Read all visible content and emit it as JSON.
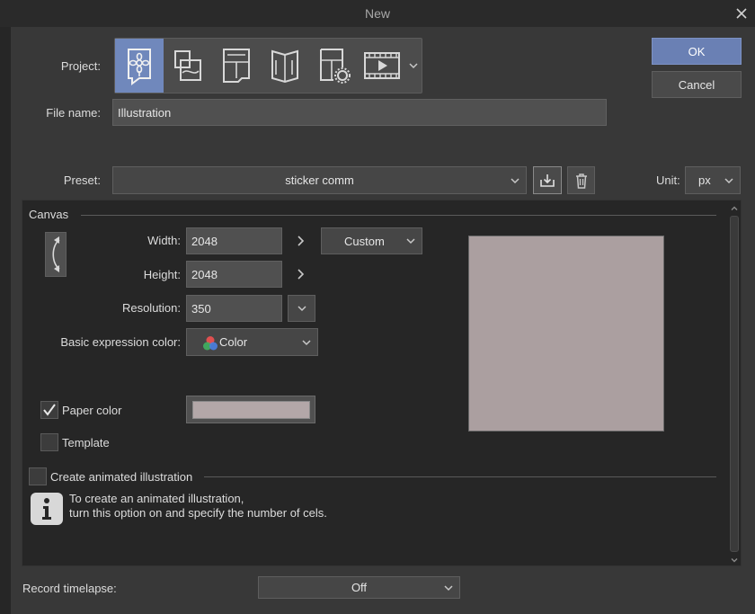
{
  "window": {
    "title": "New"
  },
  "project": {
    "label": "Project:",
    "types": [
      {
        "name": "illustration",
        "icon": "illustration-icon",
        "selected": true
      },
      {
        "name": "webtoon",
        "icon": "webtoon-icon",
        "selected": false
      },
      {
        "name": "comic",
        "icon": "comic-icon",
        "selected": false
      },
      {
        "name": "book",
        "icon": "book-icon",
        "selected": false
      },
      {
        "name": "comic-settings",
        "icon": "comic-settings-icon",
        "selected": false
      },
      {
        "name": "animation",
        "icon": "animation-icon",
        "selected": false
      }
    ]
  },
  "file_name": {
    "label": "File name:",
    "value": "Illustration"
  },
  "preset": {
    "label": "Preset:",
    "value": "sticker comm"
  },
  "unit": {
    "label": "Unit:",
    "value": "px"
  },
  "buttons": {
    "ok": "OK",
    "cancel": "Cancel"
  },
  "canvas": {
    "section_label": "Canvas",
    "width_label": "Width:",
    "width": "2048",
    "height_label": "Height:",
    "height": "2048",
    "size_preset": "Custom",
    "resolution_label": "Resolution:",
    "resolution": "350",
    "color_mode_label": "Basic expression color:",
    "color_mode": "Color",
    "paper_color_label": "Paper color",
    "paper_color_checked": true,
    "paper_color": "#b3a7a8",
    "template_label": "Template",
    "template_checked": false
  },
  "animation": {
    "label": "Create animated illustration",
    "checked": false,
    "info_line1": "To create an animated illustration,",
    "info_line2": "turn this option on and specify the number of cels."
  },
  "timelapse": {
    "label": "Record timelapse:",
    "value": "Off"
  },
  "colors": {
    "accent": "#6a80b4",
    "selected_project": "#7088bc",
    "preview": "#ab9fa0"
  }
}
